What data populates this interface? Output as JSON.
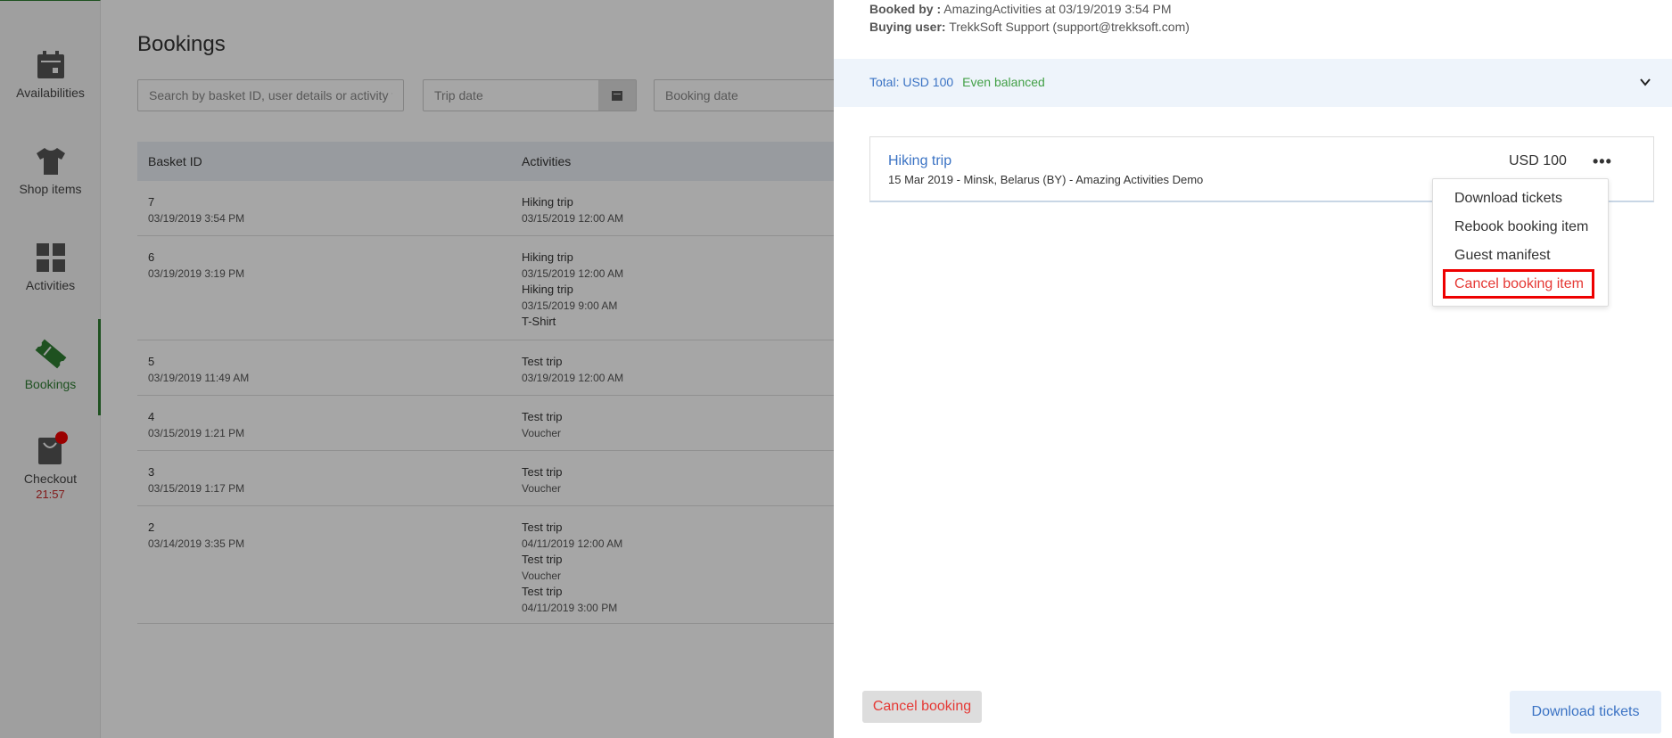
{
  "sidebar": {
    "items": [
      {
        "label": "Availabilities",
        "icon": "calendar-icon"
      },
      {
        "label": "Shop items",
        "icon": "tshirt-icon"
      },
      {
        "label": "Activities",
        "icon": "grid-icon"
      },
      {
        "label": "Bookings",
        "icon": "ticket-icon"
      },
      {
        "label": "Checkout",
        "icon": "bag-icon",
        "timer": "21:57"
      }
    ]
  },
  "page": {
    "title": "Bookings",
    "search_placeholder": "Search by basket ID, user details or activity t",
    "trip_date_placeholder": "Trip date",
    "booking_date_placeholder": "Booking date"
  },
  "table": {
    "headers": [
      "Basket ID",
      "Activities"
    ],
    "rows": [
      {
        "id": "7",
        "date": "03/19/2019 3:54 PM",
        "activities": [
          {
            "name": "Hiking trip",
            "detail": "03/15/2019 12:00 AM"
          }
        ]
      },
      {
        "id": "6",
        "date": "03/19/2019 3:19 PM",
        "activities": [
          {
            "name": "Hiking trip",
            "detail": "03/15/2019 12:00 AM"
          },
          {
            "name": "Hiking trip",
            "detail": "03/15/2019 9:00 AM"
          },
          {
            "name": "T-Shirt",
            "detail": ""
          }
        ]
      },
      {
        "id": "5",
        "date": "03/19/2019 11:49 AM",
        "activities": [
          {
            "name": "Test trip",
            "detail": "03/19/2019 12:00 AM"
          }
        ]
      },
      {
        "id": "4",
        "date": "03/15/2019 1:21 PM",
        "activities": [
          {
            "name": "Test trip",
            "detail": "Voucher"
          }
        ]
      },
      {
        "id": "3",
        "date": "03/15/2019 1:17 PM",
        "activities": [
          {
            "name": "Test trip",
            "detail": "Voucher"
          }
        ]
      },
      {
        "id": "2",
        "date": "03/14/2019 3:35 PM",
        "activities": [
          {
            "name": "Test trip",
            "detail": "04/11/2019 12:00 AM"
          },
          {
            "name": "Test trip",
            "detail": "Voucher"
          },
          {
            "name": "Test trip",
            "detail": "04/11/2019 3:00 PM"
          }
        ]
      }
    ]
  },
  "panel": {
    "booked_by_label": "Booked by :",
    "booked_by_value": "AmazingActivities at 03/19/2019 3:54 PM",
    "buying_user_label": "Buying user:",
    "buying_user_value": "TrekkSoft Support (support@trekksoft.com)",
    "total": "Total: USD 100",
    "balance_status": "Even balanced",
    "item": {
      "title": "Hiking trip",
      "subtitle": "15 Mar 2019 - Minsk, Belarus (BY) - Amazing Activities Demo",
      "price": "USD 100",
      "more": "•••"
    },
    "menu": [
      "Download tickets",
      "Rebook booking item",
      "Guest manifest",
      "Cancel booking item"
    ],
    "cancel_booking": "Cancel booking",
    "download_tickets": "Download tickets"
  },
  "colors": {
    "accent": "#2e7d32",
    "link": "#3b73c4",
    "danger": "#e53935"
  }
}
